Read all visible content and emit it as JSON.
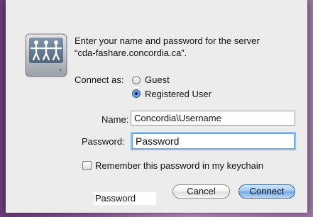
{
  "prompt": {
    "line1": "Enter your name and password for the server",
    "line2": "“cda-fashare.concordia.ca”."
  },
  "connect_as": {
    "label": "Connect as:",
    "options": [
      {
        "label": "Guest",
        "checked": false
      },
      {
        "label": "Registered User",
        "checked": true
      }
    ]
  },
  "name_field": {
    "label": "Name:",
    "value": "Concordia\\Username"
  },
  "password_field": {
    "label": "Password:",
    "value": "Password"
  },
  "remember": {
    "label": "Remember this password in my keychain",
    "checked": false
  },
  "buttons": {
    "cancel": "Cancel",
    "connect": "Connect"
  },
  "overlay_label": "Password",
  "icon": {
    "name": "shared-server-icon"
  }
}
